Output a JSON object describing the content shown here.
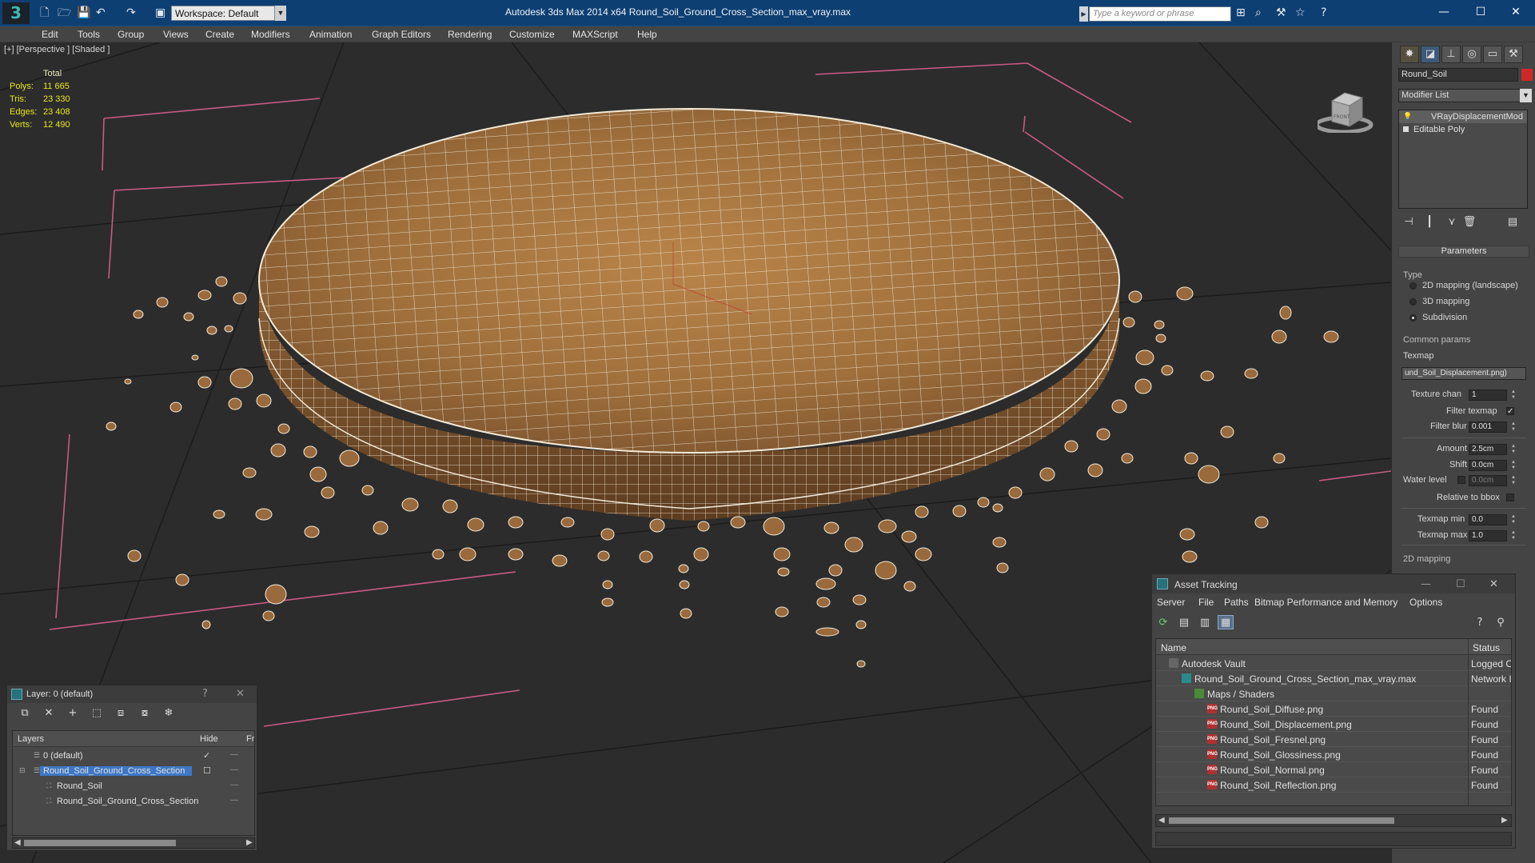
{
  "titlebar": {
    "logo_glyph": "3",
    "workspace": "Workspace: Default",
    "app_title": "Autodesk 3ds Max  2014 x64      Round_Soil_Ground_Cross_Section_max_vray.max",
    "search_placeholder": "Type a keyword or phrase",
    "window_controls": {
      "minimize": "—",
      "maximize": "☐",
      "close": "✕"
    }
  },
  "menubar": [
    "Edit",
    "Tools",
    "Group",
    "Views",
    "Create",
    "Modifiers",
    "Animation",
    "Graph Editors",
    "Rendering",
    "Customize",
    "MAXScript",
    "Help"
  ],
  "viewport": {
    "label": "[+] [Perspective ] [Shaded ]",
    "stats": {
      "header": "Total",
      "rows": [
        {
          "label": "Polys:",
          "value": "11 665"
        },
        {
          "label": "Tris:",
          "value": "23 330"
        },
        {
          "label": "Edges:",
          "value": "23 408"
        },
        {
          "label": "Verts:",
          "value": "12 490"
        }
      ]
    },
    "viewcube_label": "FRONT"
  },
  "command_panel": {
    "object_name": "Round_Soil",
    "object_color": "#d02828",
    "modifier_list_label": "Modifier List",
    "stack": [
      "VRayDisplacementMod",
      "Editable Poly"
    ],
    "params": {
      "rollout_title": "Parameters",
      "type_label": "Type",
      "types": [
        "2D mapping (landscape)",
        "3D mapping",
        "Subdivision"
      ],
      "selected_type": 2,
      "common_label": "Common params",
      "texmap_label": "Texmap",
      "texmap_value": "und_Soil_Displacement.png)",
      "texture_chan_label": "Texture chan",
      "texture_chan_value": "1",
      "filter_texmap_label": "Filter texmap",
      "filter_texmap_checked": "✓",
      "filter_blur_label": "Filter blur",
      "filter_blur_value": "0.001",
      "amount_label": "Amount",
      "amount_value": "2.5cm",
      "shift_label": "Shift",
      "shift_value": "0.0cm",
      "water_level_label": "Water level",
      "water_level_value": "0.0cm",
      "relative_bbox_label": "Relative to bbox",
      "texmap_min_label": "Texmap min",
      "texmap_min_value": "0.0",
      "texmap_max_label": "Texmap max",
      "texmap_max_value": "1.0",
      "mapping_2d_label": "2D mapping"
    }
  },
  "layer_window": {
    "title": "Layer: 0 (default)",
    "help": "?",
    "close": "✕",
    "columns": {
      "layers": "Layers",
      "hide": "Hide",
      "freeze": "Fr"
    },
    "rows": [
      {
        "name": "0 (default)",
        "indent": 0,
        "hide": "✓",
        "freeze": "—"
      },
      {
        "name": "Round_Soil_Ground_Cross_Section",
        "indent": 0,
        "hide": "☐",
        "freeze": "—",
        "selected": true
      },
      {
        "name": "Round_Soil",
        "indent": 1,
        "hide": "",
        "freeze": "—"
      },
      {
        "name": "Round_Soil_Ground_Cross_Section",
        "indent": 1,
        "hide": "",
        "freeze": "—"
      }
    ]
  },
  "asset_window": {
    "title": "Asset Tracking",
    "menu": [
      "Server",
      "File",
      "Paths",
      "Bitmap Performance and Memory",
      "Options"
    ],
    "columns": {
      "name": "Name",
      "status": "Status"
    },
    "rows": [
      {
        "name": "Autodesk Vault",
        "indent": 1,
        "icon": "vault",
        "status": "Logged O"
      },
      {
        "name": "Round_Soil_Ground_Cross_Section_max_vray.max",
        "indent": 2,
        "icon": "max",
        "status": "Network I"
      },
      {
        "name": "Maps / Shaders",
        "indent": 3,
        "icon": "folder",
        "status": ""
      },
      {
        "name": "Round_Soil_Diffuse.png",
        "indent": 4,
        "icon": "png",
        "status": "Found"
      },
      {
        "name": "Round_Soil_Displacement.png",
        "indent": 4,
        "icon": "png",
        "status": "Found"
      },
      {
        "name": "Round_Soil_Fresnel.png",
        "indent": 4,
        "icon": "png",
        "status": "Found"
      },
      {
        "name": "Round_Soil_Glossiness.png",
        "indent": 4,
        "icon": "png",
        "status": "Found"
      },
      {
        "name": "Round_Soil_Normal.png",
        "indent": 4,
        "icon": "png",
        "status": "Found"
      },
      {
        "name": "Round_Soil_Reflection.png",
        "indent": 4,
        "icon": "png",
        "status": "Found"
      }
    ],
    "png_icon_text": "PNG"
  },
  "colors": {
    "title_blue": "#0e3f73",
    "soil": "#a8753f",
    "wire": "#f4ecdc",
    "stats_yellow": "#e8e81a",
    "selection_blue": "#3e78c4",
    "bbox_pink": "#c85a85"
  }
}
